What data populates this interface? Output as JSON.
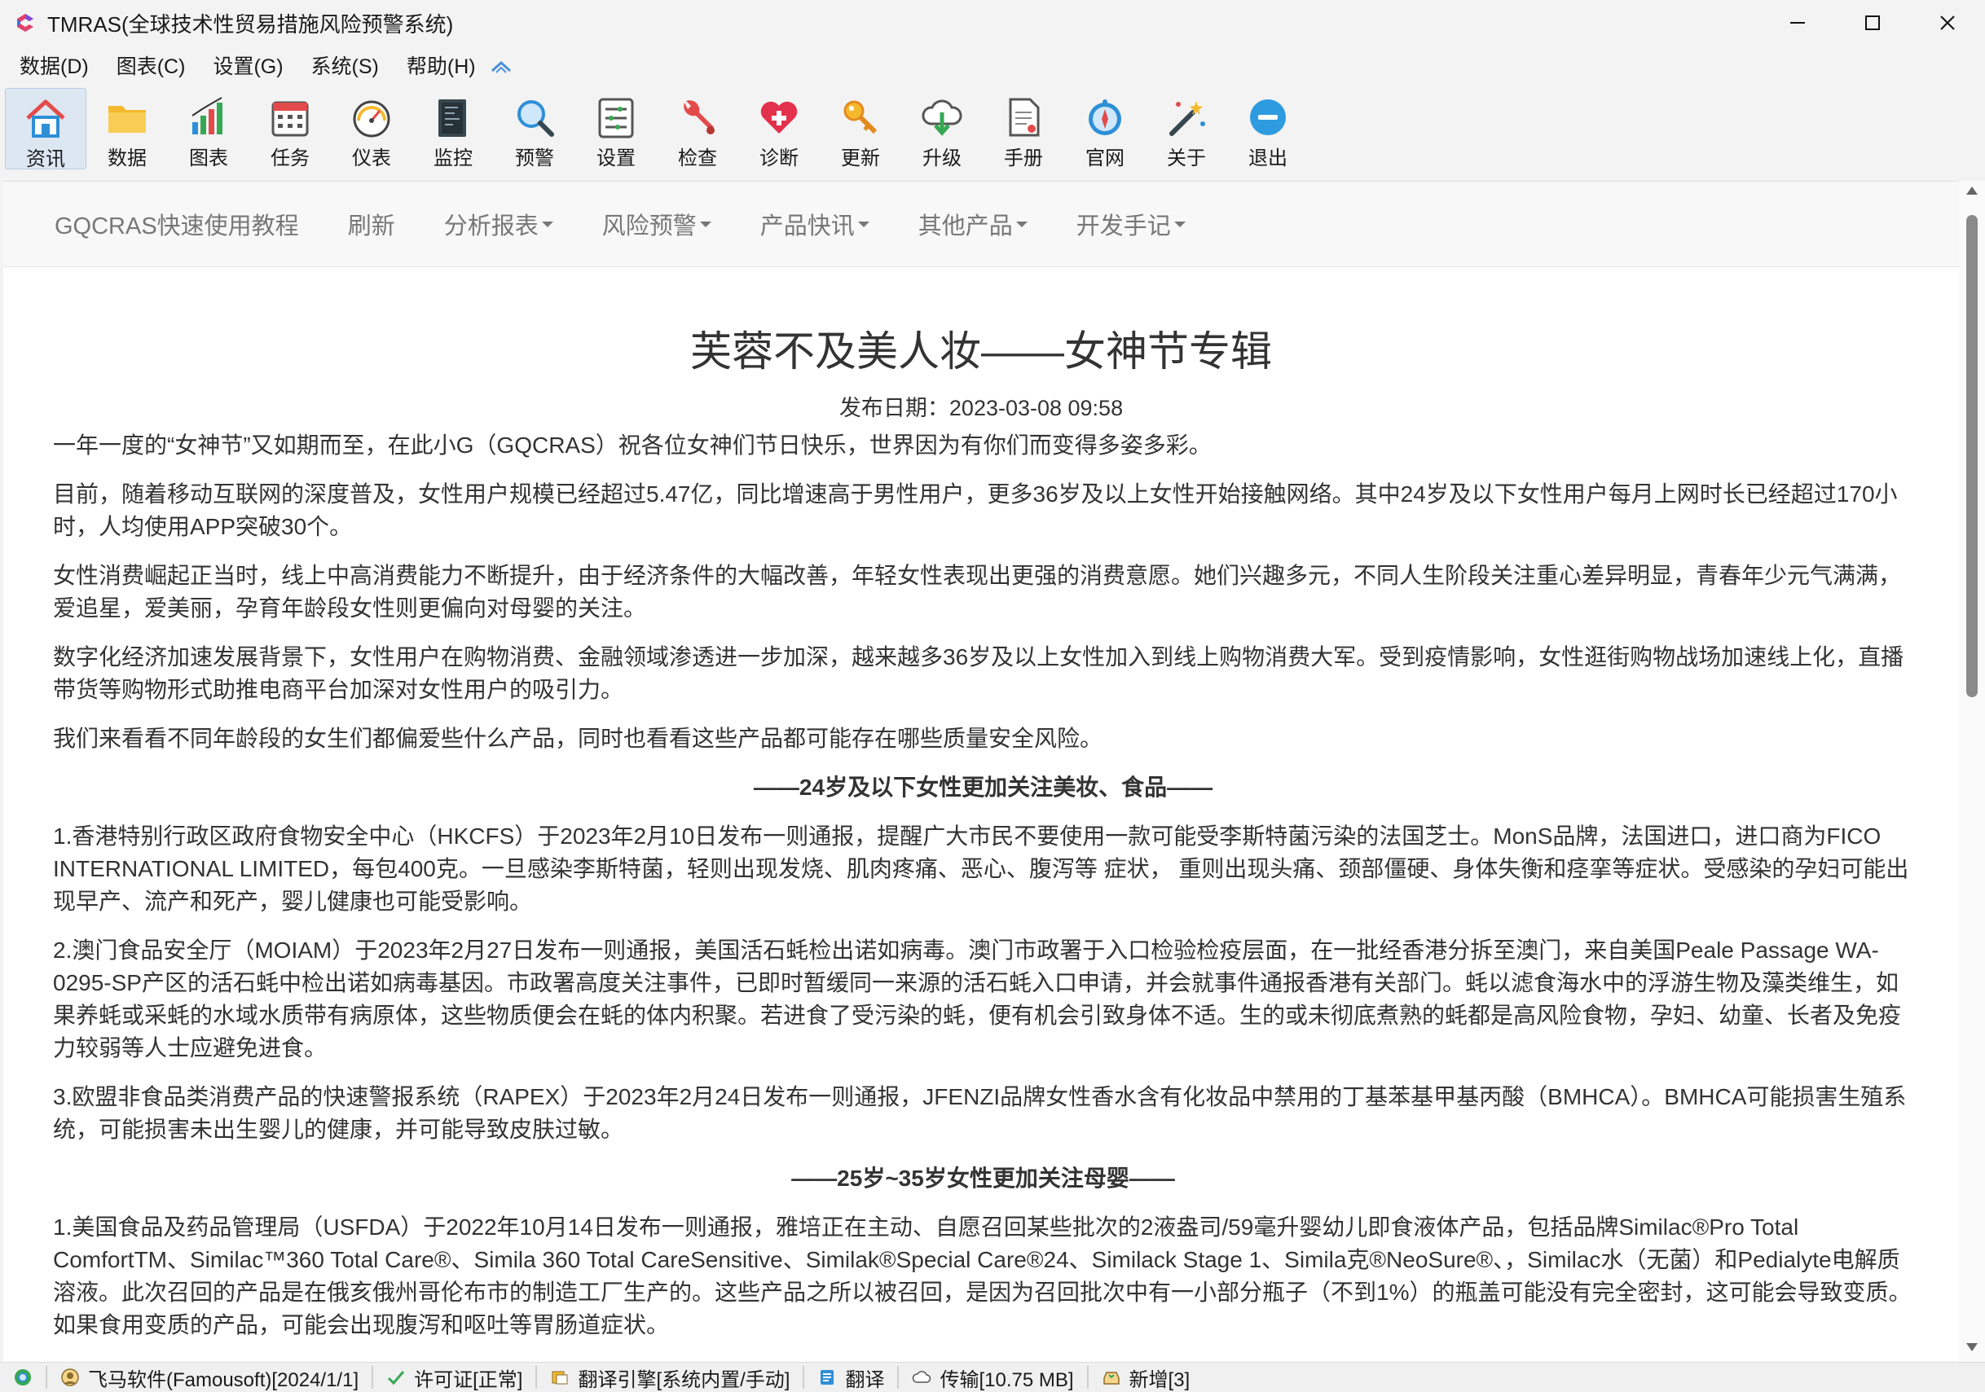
{
  "window": {
    "title": "TMRAS(全球技术性贸易措施风险预警系统)",
    "controls": [
      "minimize",
      "maximize",
      "close"
    ]
  },
  "menu": [
    {
      "label": "数据(D)"
    },
    {
      "label": "图表(C)"
    },
    {
      "label": "设置(G)"
    },
    {
      "label": "系统(S)"
    },
    {
      "label": "帮助(H)"
    }
  ],
  "toolbar": [
    {
      "label": "资讯",
      "icon": "home-icon"
    },
    {
      "label": "数据",
      "icon": "folder-icon"
    },
    {
      "label": "图表",
      "icon": "bar-chart-icon"
    },
    {
      "label": "任务",
      "icon": "calendar-icon"
    },
    {
      "label": "仪表",
      "icon": "gauge-icon"
    },
    {
      "label": "监控",
      "icon": "monitor-icon"
    },
    {
      "label": "预警",
      "icon": "magnifier-icon"
    },
    {
      "label": "设置",
      "icon": "settings-list-icon"
    },
    {
      "label": "检查",
      "icon": "wrench-icon"
    },
    {
      "label": "诊断",
      "icon": "heart-plus-icon"
    },
    {
      "label": "更新",
      "icon": "key-icon"
    },
    {
      "label": "升级",
      "icon": "cloud-download-icon"
    },
    {
      "label": "手册",
      "icon": "document-icon"
    },
    {
      "label": "官网",
      "icon": "compass-icon"
    },
    {
      "label": "关于",
      "icon": "magic-wand-icon"
    },
    {
      "label": "退出",
      "icon": "exit-icon"
    }
  ],
  "nav": [
    {
      "label": "GQCRAS快速使用教程",
      "dropdown": false
    },
    {
      "label": "刷新",
      "dropdown": false
    },
    {
      "label": "分析报表",
      "dropdown": true
    },
    {
      "label": "风险预警",
      "dropdown": true
    },
    {
      "label": "产品快讯",
      "dropdown": true
    },
    {
      "label": "其他产品",
      "dropdown": true
    },
    {
      "label": "开发手记",
      "dropdown": true
    }
  ],
  "article": {
    "title": "芙蓉不及美人妆——女神节专辑",
    "date": "发布日期：2023-03-08 09:58",
    "blocks": [
      {
        "type": "p",
        "text": "一年一度的“女神节”又如期而至，在此小G（GQCRAS）祝各位女神们节日快乐，世界因为有你们而变得多姿多彩。"
      },
      {
        "type": "p",
        "text": "目前，随着移动互联网的深度普及，女性用户规模已经超过5.47亿，同比增速高于男性用户，更多36岁及以上女性开始接触网络。其中24岁及以下女性用户每月上网时长已经超过170小时，人均使用APP突破30个。"
      },
      {
        "type": "p",
        "text": "女性消费崛起正当时，线上中高消费能力不断提升，由于经济条件的大幅改善，年轻女性表现出更强的消费意愿。她们兴趣多元，不同人生阶段关注重心差异明显，青春年少元气满满，爱追星，爱美丽，孕育年龄段女性则更偏向对母婴的关注。"
      },
      {
        "type": "p",
        "text": "数字化经济加速发展背景下，女性用户在购物消费、金融领域渗透进一步加深，越来越多36岁及以上女性加入到线上购物消费大军。受到疫情影响，女性逛街购物战场加速线上化，直播带货等购物形式助推电商平台加深对女性用户的吸引力。"
      },
      {
        "type": "p",
        "text": "我们来看看不同年龄段的女生们都偏爱些什么产品，同时也看看这些产品都可能存在哪些质量安全风险。"
      },
      {
        "type": "h",
        "text": "——24岁及以下女性更加关注美妆、食品——"
      },
      {
        "type": "p",
        "text": "1.香港特别行政区政府食物安全中心（HKCFS）于2023年2月10日发布一则通报，提醒广大市民不要使用一款可能受李斯特菌污染的法国芝士。MonS品牌，法国进口，进口商为FICO INTERNATIONAL LIMITED，每包400克。一旦感染李斯特菌，轻则出现发烧、肌肉疼痛、恶心、腹泻等 症状， 重则出现头痛、颈部僵硬、身体失衡和痉挛等症状。受感染的孕妇可能出现早产、流产和死产，婴儿健康也可能受影响。"
      },
      {
        "type": "p",
        "text": "2.澳门食品安全厅（MOIAM）于2023年2月27日发布一则通报，美国活石蚝检出诺如病毒。澳门市政署于入口检验检疫层面，在一批经香港分拆至澳门，来自美国Peale Passage WA-0295-SP产区的活石蚝中检出诺如病毒基因。市政署高度关注事件，已即时暂缓同一来源的活石蚝入口申请，并会就事件通报香港有关部门。蚝以滤食海水中的浮游生物及藻类维生，如果养蚝或采蚝的水域水质带有病原体，这些物质便会在蚝的体内积聚。若进食了受污染的蚝，便有机会引致身体不适。生的或未彻底煮熟的蚝都是高风险食物，孕妇、幼童、长者及免疫力较弱等人士应避免进食。"
      },
      {
        "type": "p",
        "text": "3.欧盟非食品类消费产品的快速警报系统（RAPEX）于2023年2月24日发布一则通报，JFENZI品牌女性香水含有化妆品中禁用的丁基苯基甲基丙酸（BMHCA）。BMHCA可能损害生殖系统，可能损害未出生婴儿的健康，并可能导致皮肤过敏。"
      },
      {
        "type": "h",
        "text": "——25岁~35岁女性更加关注母婴——"
      },
      {
        "type": "p",
        "text": "1.美国食品及药品管理局（USFDA）于2022年10月14日发布一则通报，雅培正在主动、自愿召回某些批次的2液盎司/59毫升婴幼儿即食液体产品，包括品牌Similac®Pro Total ComfortTM、Similac™360 Total Care®、Simila 360 Total CareSensitive、Similak®Special Care®24、Similack Stage 1、Simila克®NeoSure®、，Similac水（无菌）和Pedialyte电解质溶液。此次召回的产品是在俄亥俄州哥伦布市的制造工厂生产的。这些产品之所以被召回，是因为召回批次中有一小部分瓶子（不到1%）的瓶盖可能没有完全密封，这可能会导致变质。如果食用变质的产品，可能会出现腹泻和呕吐等胃肠道症状。"
      }
    ]
  },
  "status": [
    {
      "text": "",
      "icon": "globe-icon"
    },
    {
      "text": "飞马软件(Famousoft)[2024/1/1]",
      "icon": "user-icon"
    },
    {
      "text": "许可证[正常]",
      "icon": "check-icon"
    },
    {
      "text": "翻译引擎[系统内置/手动]",
      "icon": "engine-icon"
    },
    {
      "text": "翻译",
      "icon": "translate-icon"
    },
    {
      "text": "传输[10.75 MB]",
      "icon": "cloud-icon"
    },
    {
      "text": "新增[3]",
      "icon": "inbox-icon"
    }
  ],
  "colors": {
    "background": "#f3f3f3",
    "content": "#ffffff",
    "navbar": "#f8f8f8",
    "active_toolbar": "#dde7f2",
    "text": "#333333"
  }
}
